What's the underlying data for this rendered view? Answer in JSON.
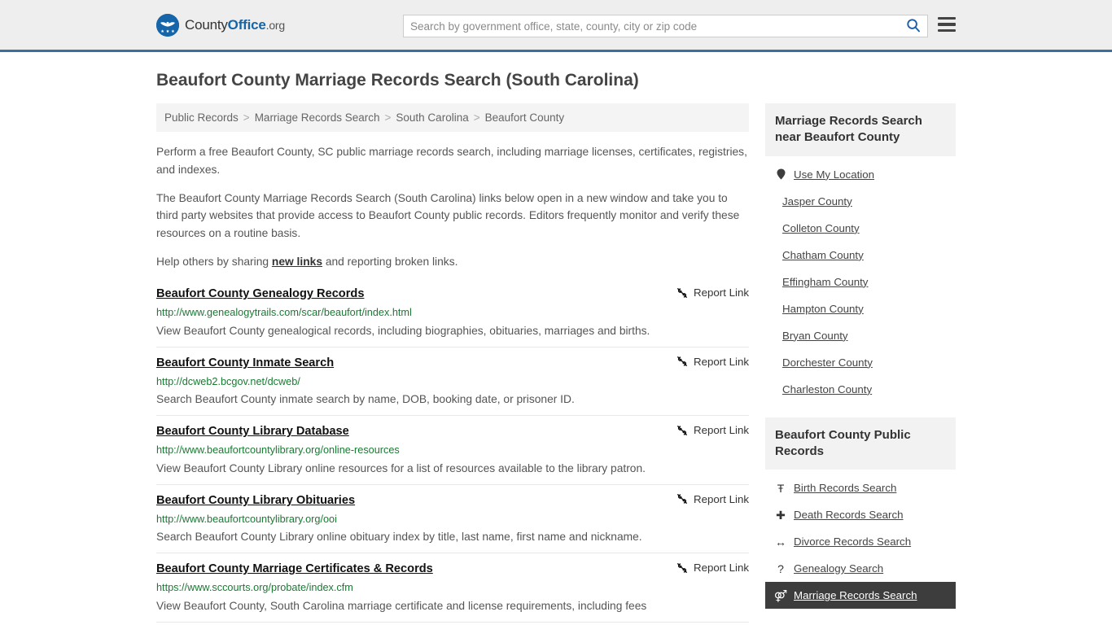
{
  "header": {
    "logo": {
      "text_county": "County",
      "text_office": "Office",
      "text_org": ".org",
      "icon": "eagle-seal-icon"
    },
    "search": {
      "placeholder": "Search by government office, state, county, city or zip code",
      "value": "",
      "button_icon": "search-icon"
    },
    "menu_icon": "hamburger-menu-icon"
  },
  "page": {
    "title": "Beaufort County Marriage Records Search (South Carolina)"
  },
  "breadcrumb": {
    "separator": ">",
    "items": [
      {
        "label": "Public Records"
      },
      {
        "label": "Marriage Records Search"
      },
      {
        "label": "South Carolina"
      },
      {
        "label": "Beaufort County"
      }
    ]
  },
  "intro": {
    "p1": "Perform a free Beaufort County, SC public marriage records search, including marriage licenses, certificates, registries, and indexes.",
    "p2": "The Beaufort County Marriage Records Search (South Carolina) links below open in a new window and take you to third party websites that provide access to Beaufort County public records. Editors frequently monitor and verify these resources on a routine basis.",
    "p3_before": "Help others by sharing ",
    "p3_link": "new links",
    "p3_after": " and reporting broken links."
  },
  "results": {
    "report_label": "Report Link",
    "report_icon": "broken-link-icon",
    "items": [
      {
        "title": "Beaufort County Genealogy Records",
        "url": "http://www.genealogytrails.com/scar/beaufort/index.html",
        "desc": "View Beaufort County genealogical records, including biographies, obituaries, marriages and births."
      },
      {
        "title": "Beaufort County Inmate Search",
        "url": "http://dcweb2.bcgov.net/dcweb/",
        "desc": "Search Beaufort County inmate search by name, DOB, booking date, or prisoner ID."
      },
      {
        "title": "Beaufort County Library Database",
        "url": "http://www.beaufortcountylibrary.org/online-resources",
        "desc": "View Beaufort County Library online resources for a list of resources available to the library patron."
      },
      {
        "title": "Beaufort County Library Obituaries",
        "url": "http://www.beaufortcountylibrary.org/ooi",
        "desc": "Search Beaufort County Library online obituary index by title, last name, first name and nickname."
      },
      {
        "title": "Beaufort County Marriage Certificates & Records",
        "url": "https://www.sccourts.org/probate/index.cfm",
        "desc": "View Beaufort County, South Carolina marriage certificate and license requirements, including fees"
      }
    ]
  },
  "sidebar": {
    "nearby": {
      "heading": "Marriage Records Search near Beaufort County",
      "items": [
        {
          "label": "Use My Location",
          "icon": "map-pin-icon"
        },
        {
          "label": "Jasper County",
          "icon": ""
        },
        {
          "label": "Colleton County",
          "icon": ""
        },
        {
          "label": "Chatham County",
          "icon": ""
        },
        {
          "label": "Effingham County",
          "icon": ""
        },
        {
          "label": "Hampton County",
          "icon": ""
        },
        {
          "label": "Bryan County",
          "icon": ""
        },
        {
          "label": "Dorchester County",
          "icon": ""
        },
        {
          "label": "Charleston County",
          "icon": ""
        }
      ]
    },
    "public_records": {
      "heading": "Beaufort County Public Records",
      "items": [
        {
          "label": "Birth Records Search",
          "icon": "baby-icon",
          "glyph": "Ŧ",
          "active": false
        },
        {
          "label": "Death Records Search",
          "icon": "cross-icon",
          "glyph": "✚",
          "active": false
        },
        {
          "label": "Divorce Records Search",
          "icon": "split-arrows-icon",
          "glyph": "↔",
          "active": false
        },
        {
          "label": "Genealogy Search",
          "icon": "question-mark-icon",
          "glyph": "?",
          "active": false
        },
        {
          "label": "Marriage Records Search",
          "icon": "male-female-icon",
          "glyph": "⚤",
          "active": true
        }
      ]
    }
  },
  "colors": {
    "brand_blue": "#1565a8",
    "header_rule": "#3a6f9f",
    "url_green": "#1a7a33",
    "panel_head_bg": "#f2f2f2",
    "active_row_bg": "#3d3d3d"
  }
}
